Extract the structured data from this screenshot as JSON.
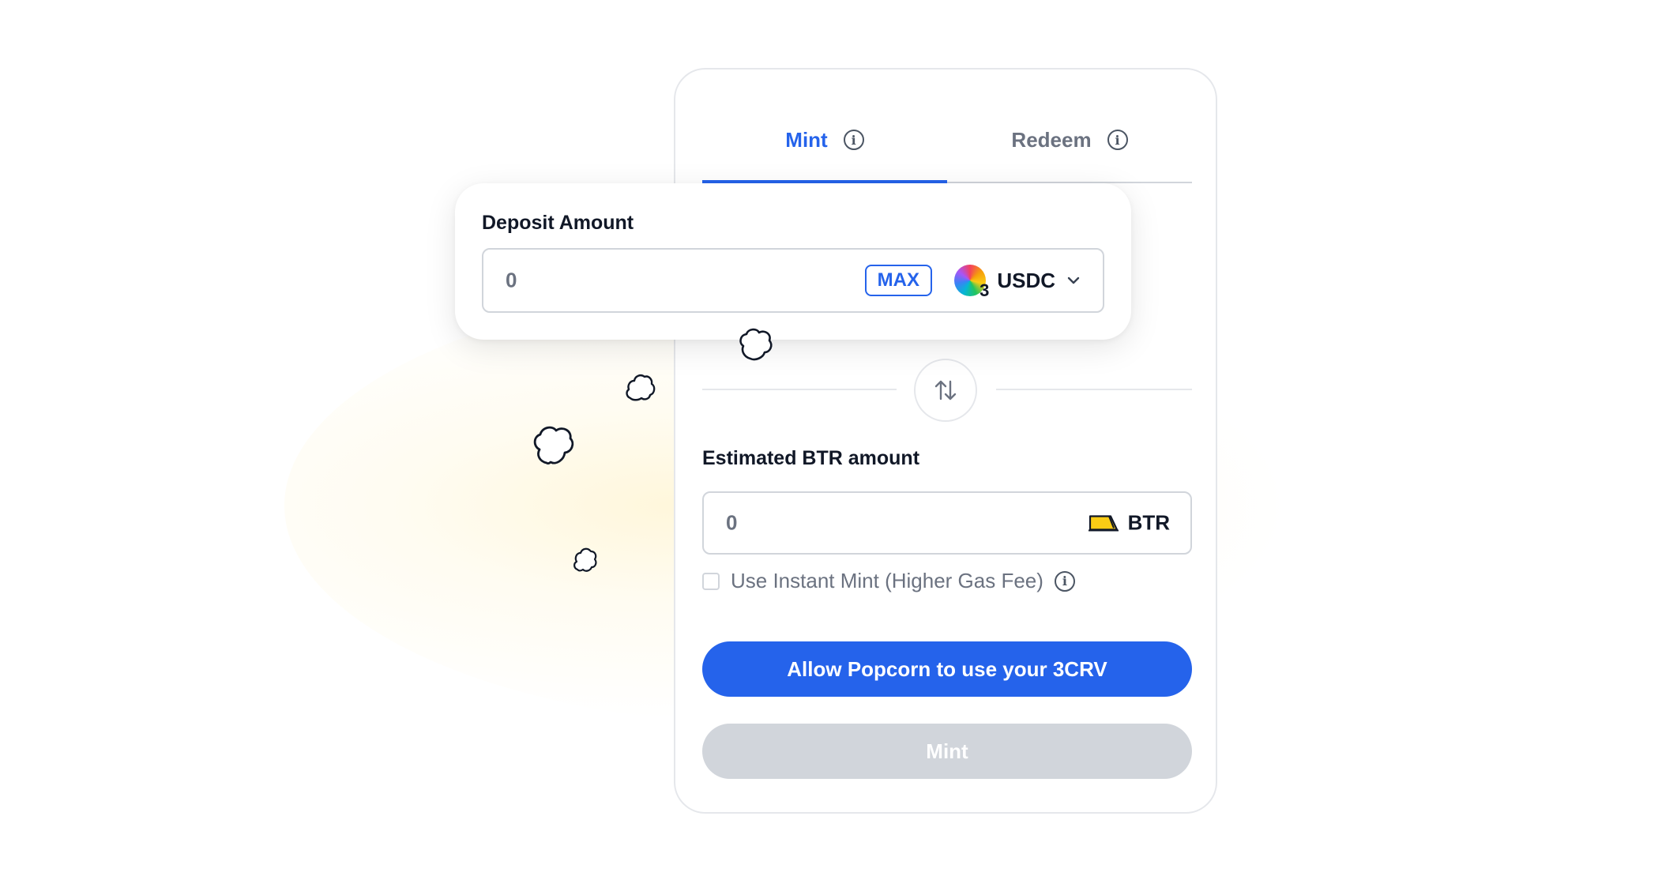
{
  "tabs": [
    {
      "label": "Mint",
      "active": true
    },
    {
      "label": "Redeem",
      "active": false
    }
  ],
  "deposit": {
    "label": "Deposit Amount",
    "value": "0",
    "max_label": "MAX",
    "token": "USDC",
    "token_icon": "usdc-3crv-icon"
  },
  "estimate": {
    "label": "Estimated BTR amount",
    "value": "0",
    "token": "BTR",
    "token_icon": "btr-token-icon"
  },
  "instant_mint": {
    "label": "Use Instant Mint (Higher Gas Fee)",
    "checked": false
  },
  "buttons": {
    "allow": "Allow Popcorn to use your 3CRV",
    "mint": "Mint"
  },
  "colors": {
    "accent": "#2563eb",
    "disabled": "#d1d5db",
    "muted_text": "#6b7280"
  }
}
